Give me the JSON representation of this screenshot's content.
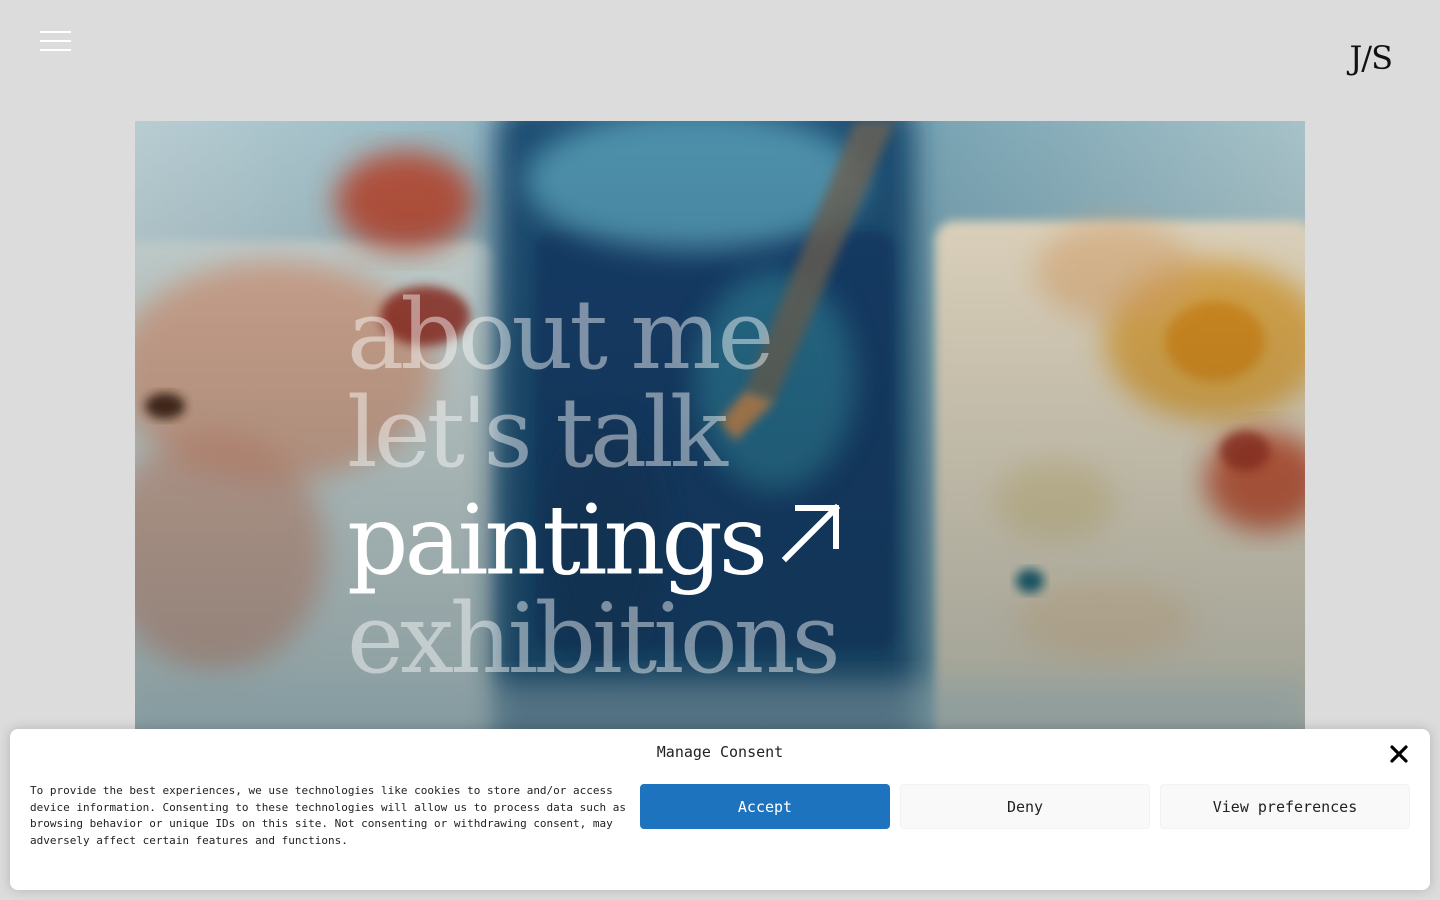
{
  "header": {
    "menu_icon": "hamburger-menu-icon",
    "logo_text": "J/S"
  },
  "hero": {
    "background": "watercolor-palette-photo",
    "nav": [
      {
        "label": "about me",
        "active": false
      },
      {
        "label": "let's talk",
        "active": false
      },
      {
        "label": "paintings",
        "active": true,
        "icon": "arrow-up-right-icon",
        "arrow": "↗"
      },
      {
        "label": "exhibitions",
        "active": false
      }
    ]
  },
  "consent": {
    "title": "Manage Consent",
    "close_icon": "close-icon",
    "text": "To provide the best experiences, we use technologies like cookies to store and/or access device information. Consenting to these technologies will allow us to process data such as browsing behavior or unique IDs on this site. Not consenting or withdrawing consent, may adversely affect certain features and functions.",
    "accept_label": "Accept",
    "deny_label": "Deny",
    "preferences_label": "View preferences",
    "accent_color": "#1e73be"
  }
}
